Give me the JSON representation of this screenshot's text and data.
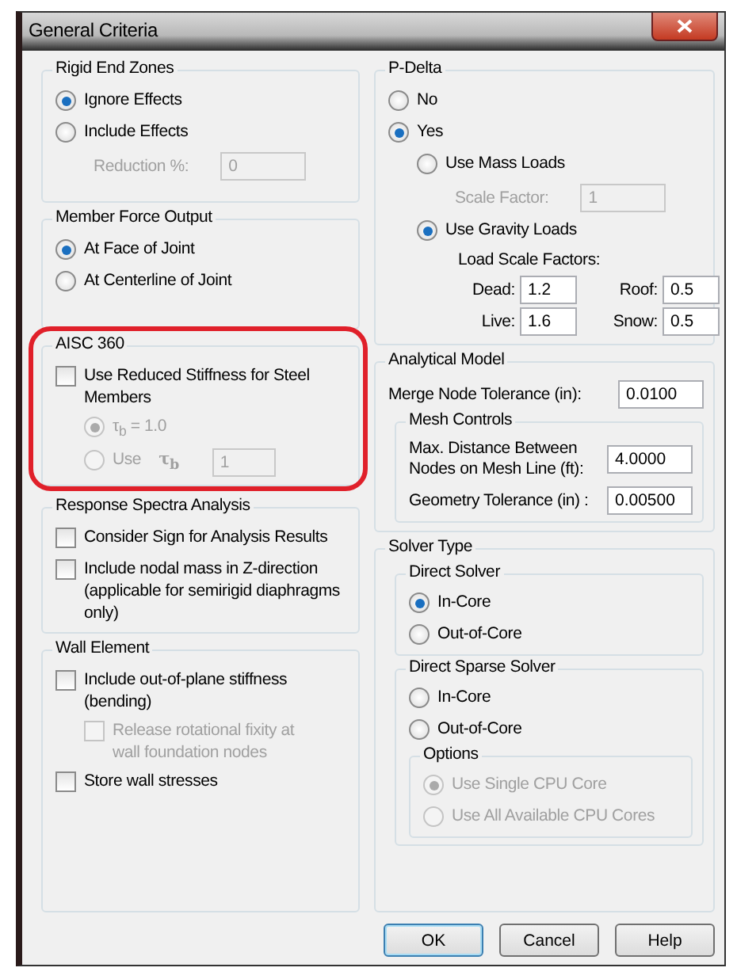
{
  "window": {
    "title": "General Criteria"
  },
  "left_groups": [
    {
      "title": "Rigid End Zones",
      "highlighted": false,
      "items": [
        {
          "kind": "radio",
          "label": "Ignore Effects",
          "selected": true,
          "disabled": false
        },
        {
          "kind": "radio",
          "label": "Include Effects",
          "selected": false,
          "disabled": false,
          "children": [
            {
              "kind": "field",
              "label": "Reduction %:",
              "value": "0",
              "disabled": true
            }
          ]
        }
      ]
    },
    {
      "title": "Member Force Output",
      "highlighted": false,
      "items": [
        {
          "kind": "radio",
          "label": "At Face of Joint",
          "selected": true,
          "disabled": false
        },
        {
          "kind": "radio",
          "label": "At Centerline of Joint",
          "selected": false,
          "disabled": false
        }
      ]
    },
    {
      "title": "AISC 360",
      "highlighted": true,
      "items": [
        {
          "kind": "checkbox",
          "label": "Use Reduced Stiffness for Steel Members",
          "checked": false,
          "disabled": false,
          "children": [
            {
              "kind": "radio",
              "label": "τ$_{b}$ = 1.0",
              "selected": true,
              "disabled": true
            },
            {
              "kind": "radio",
              "label": "Use",
              "note": "τ$_{b}$",
              "value": "1",
              "selected": false,
              "disabled": true
            }
          ]
        }
      ]
    },
    {
      "title": "Response Spectra Analysis",
      "highlighted": false,
      "items": [
        {
          "kind": "checkbox",
          "label": "Consider Sign for Analysis Results",
          "checked": false,
          "disabled": false
        },
        {
          "kind": "checkbox",
          "label": "Include nodal mass in Z-direction\n(applicable for semirigid diaphragms only)",
          "checked": false,
          "disabled": false
        }
      ]
    },
    {
      "title": "Wall Element",
      "highlighted": false,
      "items": [
        {
          "kind": "checkbox",
          "label": "Include out-of-plane stiffness (bending)",
          "checked": false,
          "disabled": false,
          "children": [
            {
              "kind": "checkbox",
              "label": "Release rotational fixity at\nwall foundation nodes",
              "checked": false,
              "disabled": true
            }
          ]
        },
        {
          "kind": "checkbox",
          "label": "Store wall stresses",
          "checked": false,
          "disabled": false
        }
      ]
    }
  ],
  "right_groups": [
    {
      "title": "P-Delta",
      "highlighted": false,
      "items": [
        {
          "kind": "radio",
          "label": "No",
          "selected": false,
          "disabled": false
        },
        {
          "kind": "radio",
          "label": "Yes",
          "selected": true,
          "disabled": false,
          "children": [
            {
              "kind": "radio",
              "label": "Use Mass Loads",
              "selected": false,
              "disabled": false,
              "children": [
                {
                  "kind": "field",
                  "label": "Scale Factor:",
                  "value": "1",
                  "disabled": true
                }
              ]
            },
            {
              "kind": "radio",
              "label": "Use Gravity Loads",
              "selected": true,
              "disabled": false,
              "children": [
                {
                  "kind": "text",
                  "label": "Load Scale Factors:"
                },
                {
                  "kind": "grid",
                  "fields": [
                    {
                      "label": "Dead:",
                      "value": "1.2"
                    },
                    {
                      "label": "Roof:",
                      "value": "0.5"
                    },
                    {
                      "label": "Live:",
                      "value": "1.6"
                    },
                    {
                      "label": "Snow:",
                      "value": "0.5"
                    }
                  ]
                }
              ]
            }
          ]
        }
      ]
    },
    {
      "title": "Analytical Model",
      "highlighted": false,
      "items": [
        {
          "kind": "field",
          "label": "Merge Node Tolerance (in):",
          "value": "0.0100",
          "disabled": false
        },
        {
          "kind": "group",
          "title": "Mesh Controls",
          "items": [
            {
              "kind": "field",
              "label": "Max. Distance Between\nNodes on Mesh Line (ft):",
              "value": "4.0000",
              "disabled": false
            },
            {
              "kind": "field",
              "label": "Geometry Tolerance (in) :",
              "value": "0.00500",
              "disabled": false
            }
          ]
        }
      ]
    },
    {
      "title": "Solver Type",
      "highlighted": false,
      "items": [
        {
          "kind": "group",
          "title": "Direct Solver",
          "items": [
            {
              "kind": "radio",
              "label": "In-Core",
              "selected": true,
              "disabled": false
            },
            {
              "kind": "radio",
              "label": "Out-of-Core",
              "selected": false,
              "disabled": false
            }
          ]
        },
        {
          "kind": "group",
          "title": "Direct Sparse Solver",
          "items": [
            {
              "kind": "radio",
              "label": "In-Core",
              "selected": false,
              "disabled": false
            },
            {
              "kind": "radio",
              "label": "Out-of-Core",
              "selected": false,
              "disabled": false
            },
            {
              "kind": "group",
              "title": "Options",
              "items": [
                {
                  "kind": "radio",
                  "label": "Use Single CPU Core",
                  "selected": true,
                  "disabled": true
                },
                {
                  "kind": "radio",
                  "label": "Use All Available CPU Cores",
                  "selected": false,
                  "disabled": true
                }
              ]
            }
          ]
        }
      ]
    }
  ],
  "buttons": [
    {
      "label": "OK",
      "default": true
    },
    {
      "label": "Cancel",
      "default": false
    },
    {
      "label": "Help",
      "default": false
    }
  ]
}
